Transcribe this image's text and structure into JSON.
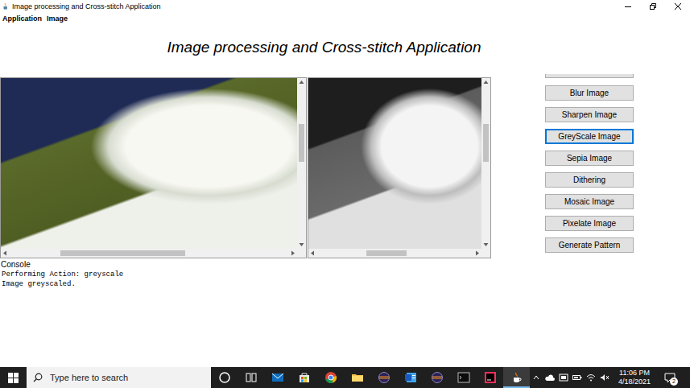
{
  "window": {
    "title": "Image processing and Cross-stitch Application"
  },
  "menu": [
    {
      "label": "Application"
    },
    {
      "label": "Image"
    }
  ],
  "heading": "Image processing and Cross-stitch Application",
  "panes": [
    {
      "kind": "color",
      "scroll_x": 0.33,
      "scroll_y": 0.32
    },
    {
      "kind": "grey",
      "scroll_x": 0.43,
      "scroll_y": 0.32
    }
  ],
  "buttons": [
    {
      "label": "Blur Image",
      "selected": false
    },
    {
      "label": "Sharpen Image",
      "selected": false
    },
    {
      "label": "GreyScale Image",
      "selected": true
    },
    {
      "label": "Sepia Image",
      "selected": false
    },
    {
      "label": "Dithering",
      "selected": false
    },
    {
      "label": "Mosaic Image",
      "selected": false
    },
    {
      "label": "Pixelate Image",
      "selected": false
    },
    {
      "label": "Generate Pattern",
      "selected": false
    }
  ],
  "console": {
    "label": "Console",
    "lines": [
      "Performing Action: greyscale",
      "Image greyscaled."
    ]
  },
  "taskbar": {
    "search": {
      "placeholder": "Type here to search"
    },
    "apps": [
      {
        "kind": "cortana",
        "active": false
      },
      {
        "kind": "taskview",
        "active": false
      },
      {
        "kind": "mail",
        "active": false
      },
      {
        "kind": "store",
        "active": false
      },
      {
        "kind": "chrome",
        "active": false
      },
      {
        "kind": "files",
        "active": false
      },
      {
        "kind": "eclipse",
        "active": false
      },
      {
        "kind": "word",
        "active": false
      },
      {
        "kind": "eclipse",
        "active": false
      },
      {
        "kind": "cmd",
        "active": false
      },
      {
        "kind": "intellij",
        "active": false
      },
      {
        "kind": "java",
        "active": true
      }
    ],
    "clock": {
      "time": "11:06 PM",
      "date": "4/18/2021"
    },
    "notifications": {
      "count": "2"
    }
  }
}
